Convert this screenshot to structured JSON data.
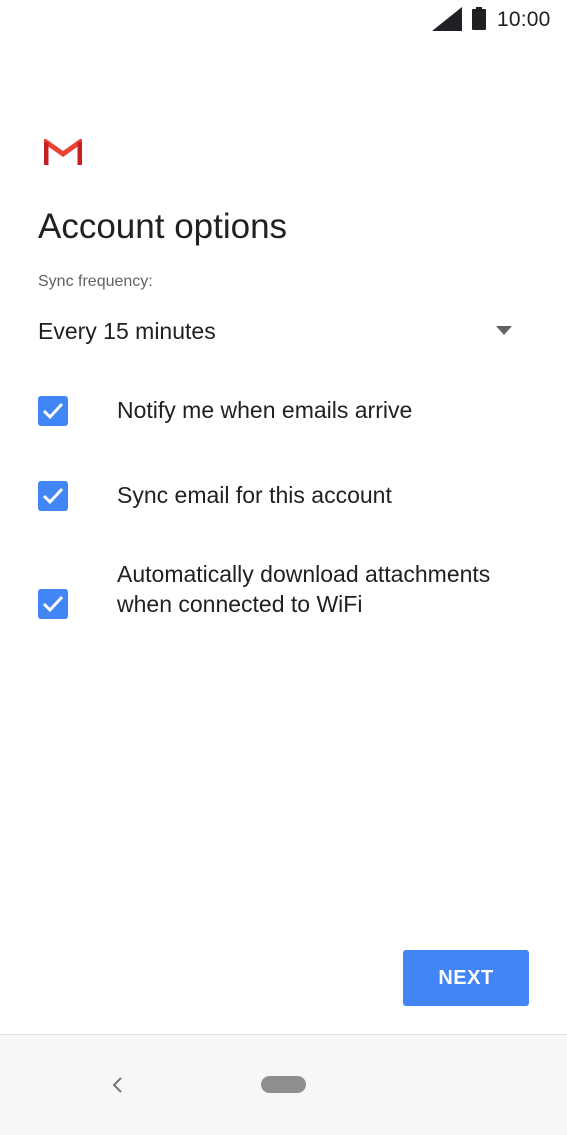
{
  "status_bar": {
    "time": "10:00",
    "signal_icon": "signal-icon",
    "battery_icon": "battery-icon"
  },
  "header": {
    "logo_icon": "gmail-logo-icon",
    "title": "Account options"
  },
  "sync": {
    "label": "Sync frequency:",
    "selected_value": "Every 15 minutes",
    "arrow_icon": "dropdown-arrow-icon"
  },
  "options": [
    {
      "label": "Notify me when emails arrive",
      "checked": true
    },
    {
      "label": "Sync email for this account",
      "checked": true
    },
    {
      "label": "Automatically download attachments when connected to WiFi",
      "checked": true
    }
  ],
  "actions": {
    "next_label": "NEXT"
  },
  "nav_bar": {
    "back_icon": "back-icon",
    "home_icon": "home-icon"
  },
  "colors": {
    "accent": "#4285f4",
    "gmail_red": "#ea4335",
    "text_primary": "#202124",
    "text_secondary": "#5f6368"
  }
}
